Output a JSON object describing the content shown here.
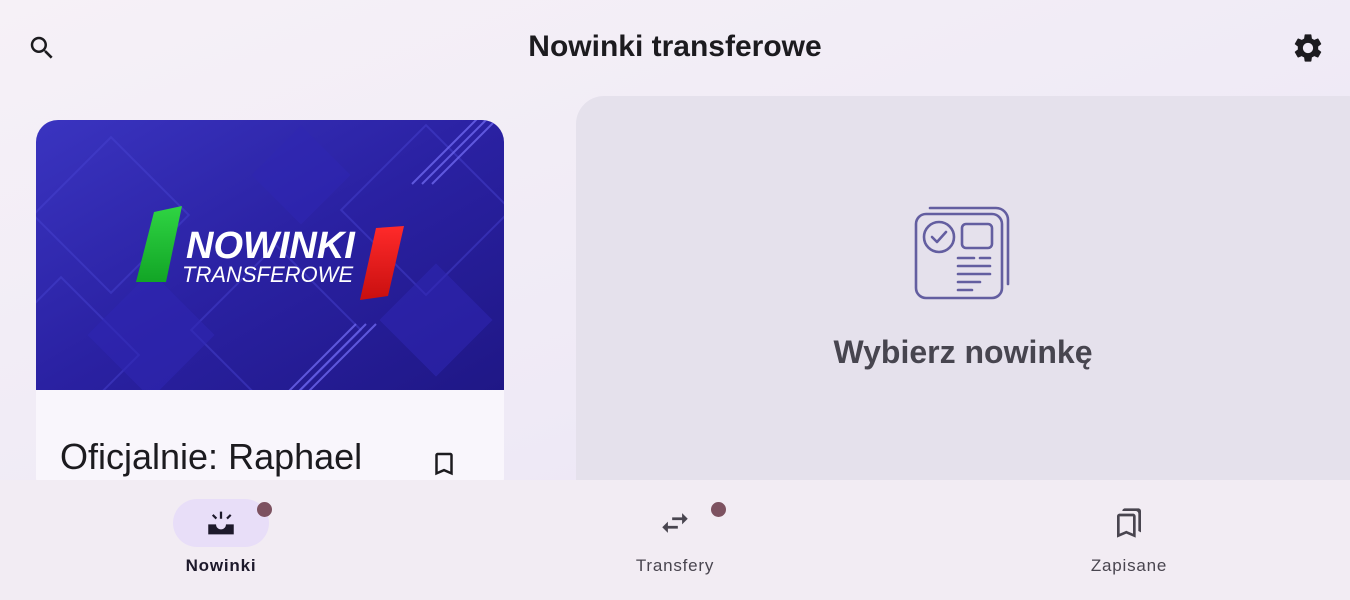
{
  "app": {
    "title": "Nowinki transferowe"
  },
  "header": {
    "search_icon": "search-icon",
    "settings_icon": "gear-icon"
  },
  "feed": {
    "items": [
      {
        "banner": {
          "line1": "NOWINKI",
          "line2": "TRANSFEROWE"
        },
        "title": "Oficjalnie: Raphael",
        "bookmark_icon": "bookmark-outline-icon"
      }
    ]
  },
  "detail": {
    "empty_text": "Wybierz nowinkę",
    "icon": "article-icon"
  },
  "bottom_nav": {
    "items": [
      {
        "label": "Nowinki",
        "icon": "inbox-new-icon",
        "active": true,
        "badge": true
      },
      {
        "label": "Transfery",
        "icon": "swap-icon",
        "active": false,
        "badge": true
      },
      {
        "label": "Zapisane",
        "icon": "bookmarks-icon",
        "active": false,
        "badge": false
      }
    ]
  },
  "colors": {
    "accent": "#e8def8",
    "badge": "#7d5260",
    "banner_blue": "#2a21a2",
    "stripe_green": "#18c42e",
    "stripe_red": "#e21313"
  }
}
